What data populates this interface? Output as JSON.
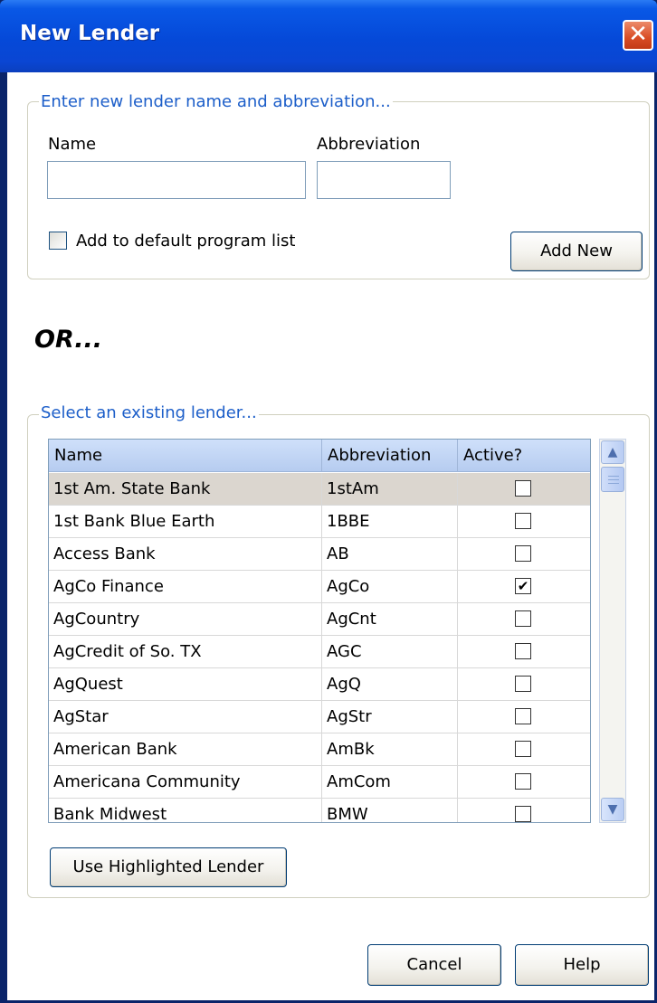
{
  "window": {
    "title": "New Lender",
    "close_glyph": "✕"
  },
  "new_lender_group": {
    "legend": "Enter new lender name and abbreviation...",
    "name_label": "Name",
    "name_value": "",
    "abbreviation_label": "Abbreviation",
    "abbreviation_value": "",
    "default_list_label": "Add to default program list",
    "default_list_checked": false,
    "add_button": "Add New"
  },
  "or_text": "OR...",
  "existing_group": {
    "legend": "Select an existing lender...",
    "columns": [
      "Name",
      "Abbreviation",
      "Active?"
    ],
    "rows": [
      {
        "name": "1st Am. State Bank",
        "abbr": "1stAm",
        "active": false,
        "selected": true
      },
      {
        "name": "1st Bank Blue Earth",
        "abbr": "1BBE",
        "active": false
      },
      {
        "name": "Access Bank",
        "abbr": "AB",
        "active": false
      },
      {
        "name": "AgCo Finance",
        "abbr": "AgCo",
        "active": true
      },
      {
        "name": "AgCountry",
        "abbr": "AgCnt",
        "active": false
      },
      {
        "name": "AgCredit of So. TX",
        "abbr": "AGC",
        "active": false
      },
      {
        "name": "AgQuest",
        "abbr": "AgQ",
        "active": false
      },
      {
        "name": "AgStar",
        "abbr": "AgStr",
        "active": false
      },
      {
        "name": "American Bank",
        "abbr": "AmBk",
        "active": false
      },
      {
        "name": "Americana Community",
        "abbr": "AmCom",
        "active": false
      },
      {
        "name": "Bank Midwest",
        "abbr": "BMW",
        "active": false
      }
    ],
    "use_button": "Use Highlighted Lender"
  },
  "footer": {
    "cancel": "Cancel",
    "help": "Help"
  },
  "colors": {
    "titlebar": "#0549d8",
    "legend_text": "#1c5ec9",
    "selected_row": "#dbd6cf"
  }
}
